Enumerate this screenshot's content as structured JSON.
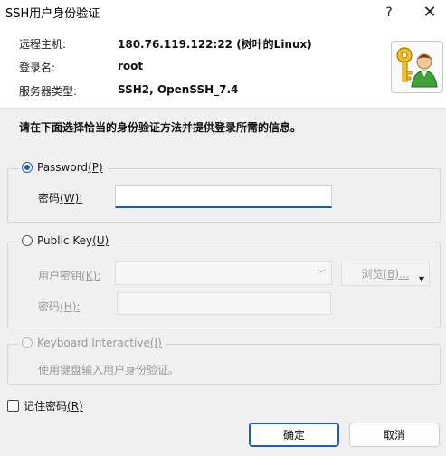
{
  "window": {
    "title": "SSH用户身份验证",
    "help_glyph": "?",
    "close_glyph": "✕"
  },
  "header": {
    "rows": [
      {
        "label": "远程主机:",
        "value": "180.76.119.122:22 (树叶的Linux)"
      },
      {
        "label": "登录名:",
        "value": "root"
      },
      {
        "label": "服务器类型:",
        "value": "SSH2, OpenSSH_7.4"
      }
    ],
    "icon": "user-key-icon"
  },
  "instruction": "请在下面选择恰当的身份验证方法并提供登录所需的信息。",
  "password_group": {
    "radio_label": "Password",
    "radio_hotkey": "(P)",
    "selected": true,
    "field_label": "密码",
    "field_hotkey": "(W):",
    "field_value": ""
  },
  "public_key_group": {
    "radio_label": "Public Key",
    "radio_hotkey": "(U)",
    "selected": false,
    "key_label": "用户密钥",
    "key_hotkey": "(K):",
    "browse_label": "浏览",
    "browse_hotkey": "(B)...",
    "passphrase_label": "密码",
    "passphrase_hotkey": "(H):"
  },
  "keyboard_group": {
    "radio_label": "Keyboard Interactive",
    "radio_hotkey": "(I)",
    "description": "使用键盘输入用户身份验证。"
  },
  "remember": {
    "label": "记住密码",
    "hotkey": "(R)",
    "checked": false
  },
  "buttons": {
    "ok": "确定",
    "cancel": "取消"
  },
  "colors": {
    "accent": "#1a5fb4",
    "window_bg": "#f0f0f0",
    "header_bg": "#ffffff"
  }
}
